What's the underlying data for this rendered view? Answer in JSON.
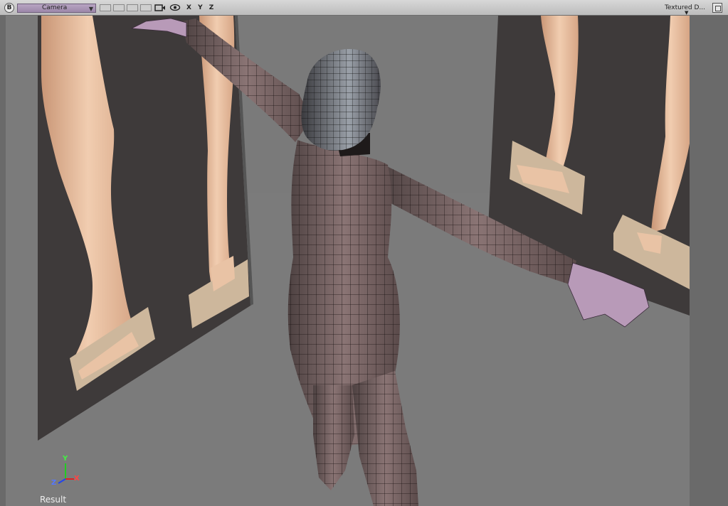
{
  "header": {
    "b_label": "B",
    "camera_label": "Camera",
    "axes_label": "X Y Z",
    "render_mode": "Textured D..."
  },
  "viewport": {
    "result_label": "Result",
    "axis_labels": {
      "x": "X",
      "y": "Y",
      "z": "Z"
    }
  },
  "colors": {
    "background": "#747474",
    "floor": "#7b7b7b",
    "wall": "#3e3a3a",
    "skin": "#e2b99a",
    "mesh": "#6a5a5a",
    "hands": "#b89ab8"
  }
}
